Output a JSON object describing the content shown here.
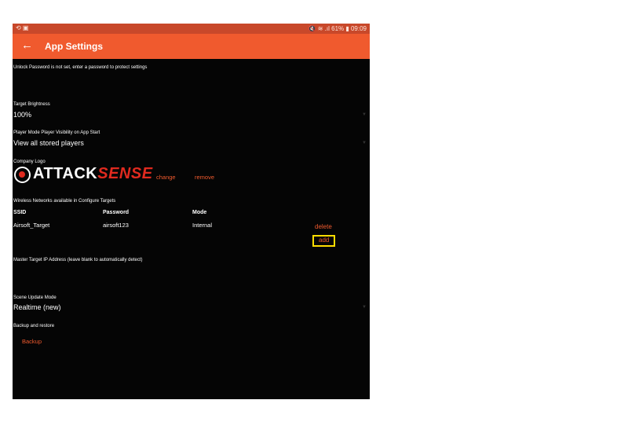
{
  "status_bar": {
    "left_icons": "⟲ ▣",
    "right": "🔇 ≋ .ıl 61% ▮ 09:09"
  },
  "app_bar": {
    "title": "App Settings"
  },
  "unlock": {
    "label": "Unlock Password is not set, enter a password to protect settings"
  },
  "brightness": {
    "label": "Target Brightness",
    "value": "100%"
  },
  "player_mode": {
    "label": "Player Mode Player Visibility on App Start",
    "value": "View all stored players"
  },
  "company_logo": {
    "label": "Company Logo",
    "logo_text_a": "ATTACK",
    "logo_text_b": "SENSE",
    "change_label": "change",
    "remove_label": "remove"
  },
  "wireless": {
    "label": "Wireless Networks available in Configure Targets",
    "columns": [
      "SSID",
      "Password",
      "Mode"
    ],
    "rows": [
      {
        "ssid": "Airsoft_Target",
        "password": "airsoft123",
        "mode": "Internal"
      }
    ],
    "delete_label": "delete",
    "add_label": "add"
  },
  "master_ip": {
    "label": "Master Target IP Address (leave blank to automatically detect)"
  },
  "scene_update": {
    "label": "Scene Update Mode",
    "value": "Realtime (new)"
  },
  "backup": {
    "label": "Backup and restore",
    "button_label": "Backup"
  },
  "colors": {
    "accent": "#f05a2e",
    "status_bar": "#c8482a",
    "background": "#050505",
    "highlight_box": "#ffdd00",
    "logo_red": "#e02a1f"
  },
  "icons": {
    "back": "arrow-left-icon",
    "dropdown": "triangle-down-icon"
  }
}
